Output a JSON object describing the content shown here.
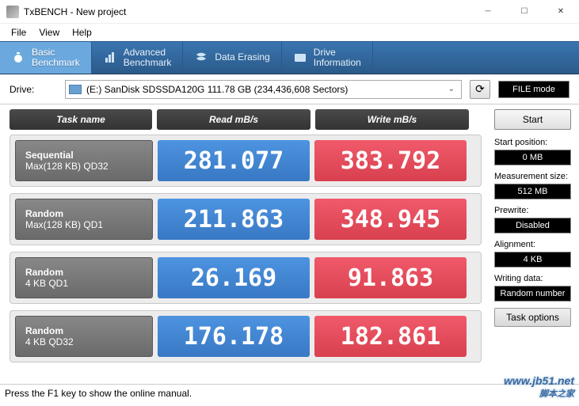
{
  "window": {
    "title": "TxBENCH - New project"
  },
  "menu": {
    "file": "File",
    "view": "View",
    "help": "Help"
  },
  "tabs": {
    "basic": "Basic\nBenchmark",
    "advanced": "Advanced\nBenchmark",
    "erasing": "Data Erasing",
    "drive": "Drive\nInformation"
  },
  "drivebar": {
    "label": "Drive:",
    "value": "(E:) SanDisk SDSSDA120G   111.78 GB (234,436,608 Sectors)",
    "filemode": "FILE mode"
  },
  "headers": {
    "task": "Task name",
    "read": "Read mB/s",
    "write": "Write mB/s"
  },
  "rows": [
    {
      "t1": "Sequential",
      "t2": "Max(128 KB) QD32",
      "read": "281.077",
      "write": "383.792"
    },
    {
      "t1": "Random",
      "t2": "Max(128 KB) QD1",
      "read": "211.863",
      "write": "348.945"
    },
    {
      "t1": "Random",
      "t2": "4 KB QD1",
      "read": "26.169",
      "write": "91.863"
    },
    {
      "t1": "Random",
      "t2": "4 KB QD32",
      "read": "176.178",
      "write": "182.861"
    }
  ],
  "side": {
    "start": "Start",
    "startpos_label": "Start position:",
    "startpos": "0 MB",
    "meassize_label": "Measurement size:",
    "meassize": "512 MB",
    "prewrite_label": "Prewrite:",
    "prewrite": "Disabled",
    "align_label": "Alignment:",
    "align": "4 KB",
    "writedata_label": "Writing data:",
    "writedata": "Random number",
    "taskopt": "Task options"
  },
  "status": "Press the F1 key to show the online manual.",
  "watermark": {
    "url": "www.jb51.net",
    "tag": "脚本之家"
  }
}
